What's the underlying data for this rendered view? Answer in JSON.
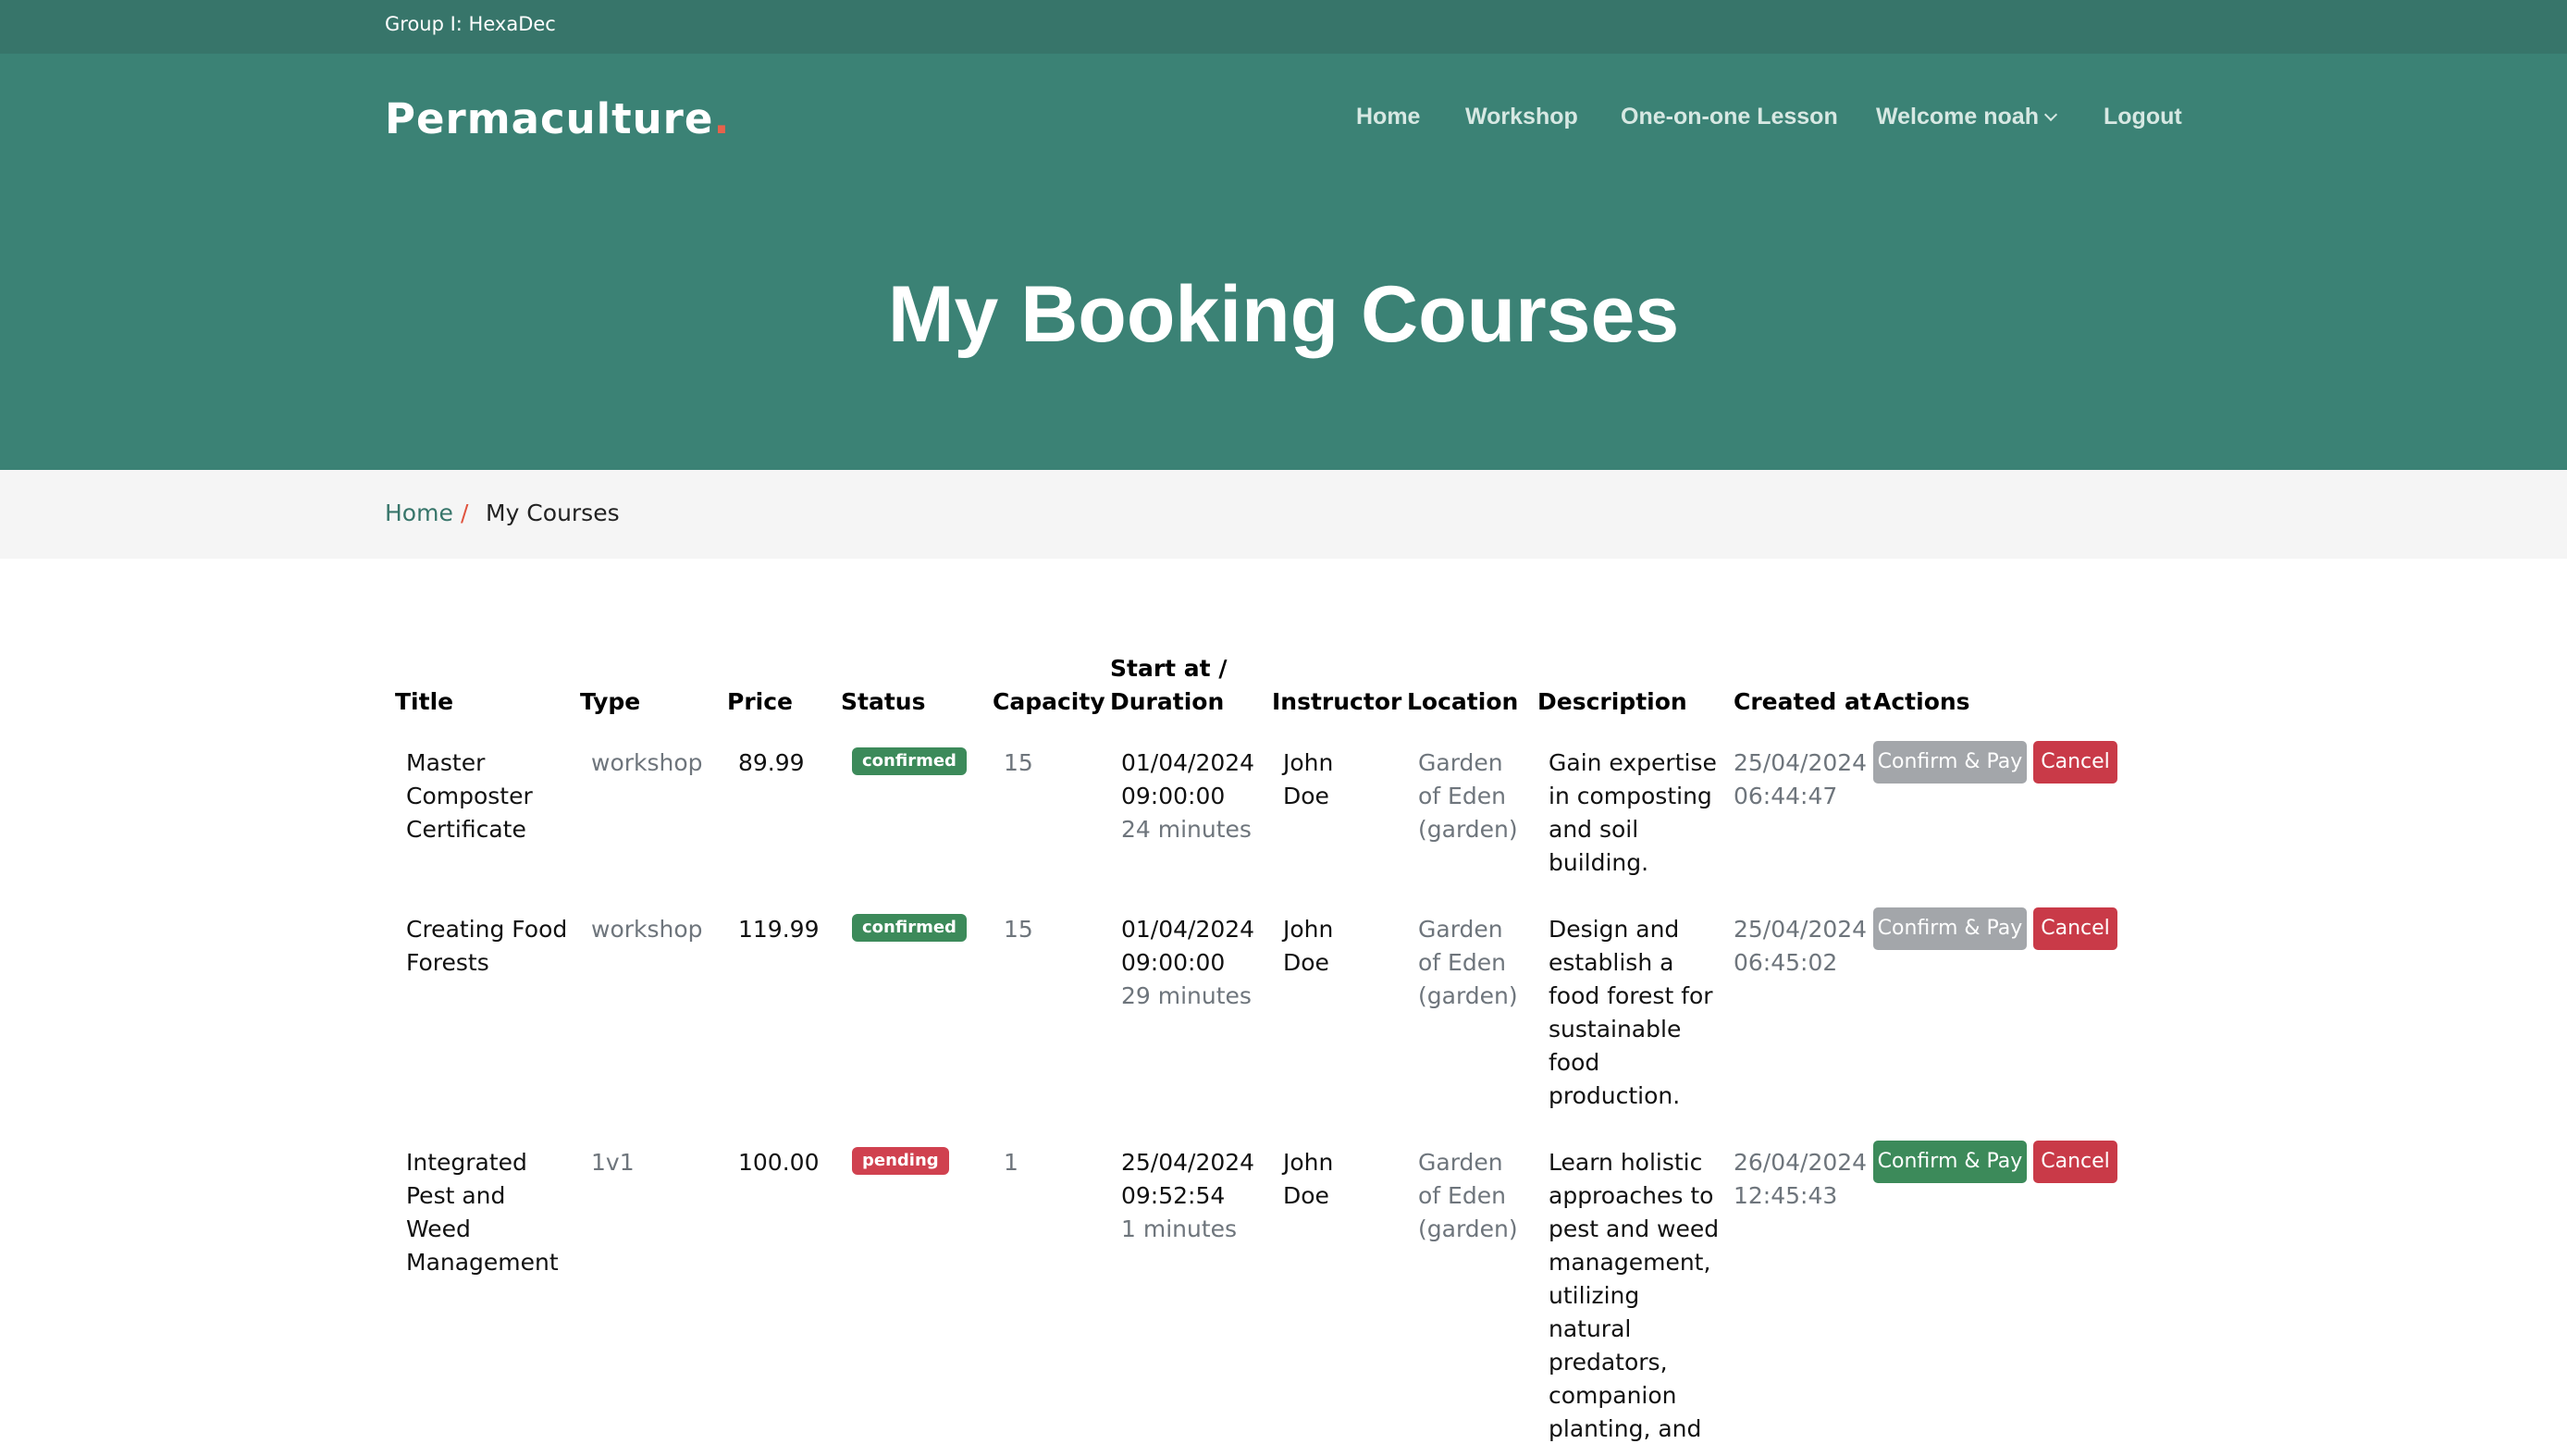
{
  "topbar": {
    "text": "Group I: HexaDec"
  },
  "brand": {
    "name": "Permaculture",
    "dot": "."
  },
  "nav": {
    "home": "Home",
    "workshop": "Workshop",
    "lesson": "One-on-one Lesson",
    "welcome": "Welcome noah",
    "logout": "Logout"
  },
  "hero": {
    "title": "My Booking Courses"
  },
  "breadcrumb": {
    "home": "Home",
    "separator": "/",
    "current": "My Courses"
  },
  "table": {
    "headers": {
      "title": "Title",
      "type": "Type",
      "price": "Price",
      "status": "Status",
      "capacity": "Capacity",
      "start_line1": "Start at /",
      "start_line2": "Duration",
      "instructor": "Instructor",
      "location": "Location",
      "description": "Description",
      "created": "Created at",
      "actions": "Actions"
    },
    "rows": [
      {
        "title": "Master Composter Certificate",
        "type": "workshop",
        "price": "89.99",
        "status": "confirmed",
        "capacity": "15",
        "start_date": "01/04/2024",
        "start_time": "09:00:00",
        "duration": "24 minutes",
        "instructor": "John Doe",
        "location": "Garden of Eden (garden)",
        "description": "Gain expertise in composting and soil building.",
        "created_date": "25/04/2024",
        "created_time": "06:44:47",
        "confirm_label": "Confirm & Pay",
        "cancel_label": "Cancel"
      },
      {
        "title": "Creating Food Forests",
        "type": "workshop",
        "price": "119.99",
        "status": "confirmed",
        "capacity": "15",
        "start_date": "01/04/2024",
        "start_time": "09:00:00",
        "duration": "29 minutes",
        "instructor": "John Doe",
        "location": "Garden of Eden (garden)",
        "description": "Design and establish a food forest for sustainable food production.",
        "created_date": "25/04/2024",
        "created_time": "06:45:02",
        "confirm_label": "Confirm & Pay",
        "cancel_label": "Cancel"
      },
      {
        "title": "Integrated Pest and Weed Management",
        "type": "1v1",
        "price": "100.00",
        "status": "pending",
        "capacity": "1",
        "start_date": "25/04/2024",
        "start_time": "09:52:54",
        "duration": "1 minutes",
        "instructor": "John Doe",
        "location": "Garden of Eden (garden)",
        "description": "Learn holistic approaches to pest and weed management, utilizing natural predators, companion planting, and",
        "created_date": "26/04/2024",
        "created_time": "12:45:43",
        "confirm_label": "Confirm & Pay",
        "cancel_label": "Cancel"
      }
    ]
  },
  "colors": {
    "topbar": "#37756a",
    "hero": "#3b8275",
    "accent_green": "#3c8a5a",
    "danger_red": "#c93a48",
    "disabled_gray": "#a3a6aa",
    "brand_dot": "#e8624b"
  }
}
